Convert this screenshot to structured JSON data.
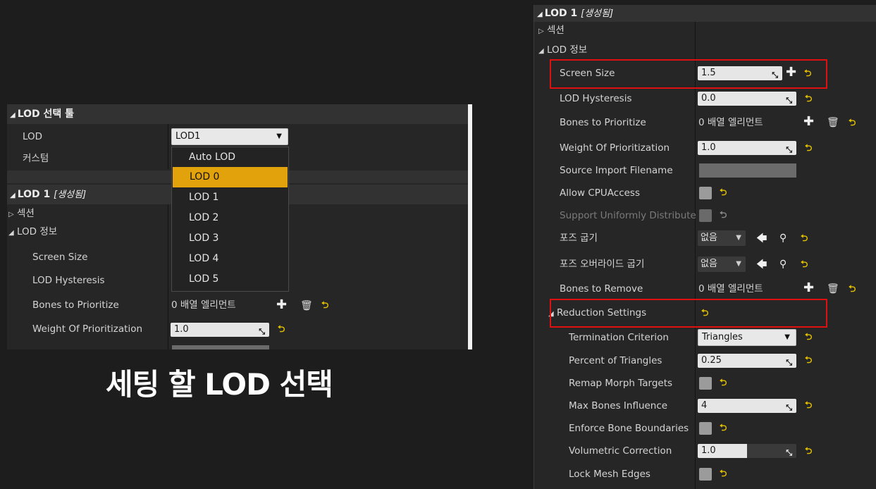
{
  "left_panel": {
    "category_lod_tool": "LOD 선택 툴",
    "lod_label": "LOD",
    "lod_selected": "LOD1",
    "custom_label": "커스텀",
    "category_lod1": "LOD 1",
    "generated_tag": "[생성됨]",
    "section_label": "섹션",
    "lod_info_label": "LOD 정보",
    "screen_size": "Screen Size",
    "lod_hysteresis": "LOD Hysteresis",
    "bones_to_prioritize": "Bones to Prioritize",
    "bones_value": "0 배열 엘리먼트",
    "weight_of_prioritization": "Weight Of Prioritization",
    "weight_value": "1.0",
    "dropdown_options": [
      "Auto LOD",
      "LOD 0",
      "LOD 1",
      "LOD 2",
      "LOD 3",
      "LOD 4",
      "LOD 5"
    ],
    "dropdown_highlighted": "LOD 0"
  },
  "caption": "세팅 할 LOD 선택",
  "right_panel": {
    "category_lod1": "LOD 1",
    "generated_tag": "[생성됨]",
    "section_label": "섹션",
    "lod_info_label": "LOD 정보",
    "screen_size": "Screen Size",
    "screen_size_value": "1.5",
    "lod_hysteresis": "LOD Hysteresis",
    "lod_hysteresis_value": "0.0",
    "bones_to_prioritize": "Bones to Prioritize",
    "bones_to_prioritize_value": "0 배열 엘리먼트",
    "weight_of_prioritization": "Weight Of Prioritization",
    "weight_value": "1.0",
    "source_import_filename": "Source Import Filename",
    "allow_cpu_access": "Allow CPUAccess",
    "support_uniformly_distribute": "Support Uniformly Distribute",
    "pose_bake": "포즈 굽기",
    "pose_bake_value": "없음",
    "pose_override_bake": "포즈 오버라이드 굽기",
    "pose_override_value": "없음",
    "bones_to_remove": "Bones to Remove",
    "bones_to_remove_value": "0 배열 엘리먼트",
    "reduction_settings": "Reduction Settings",
    "termination_criterion": "Termination Criterion",
    "termination_value": "Triangles",
    "percent_of_triangles": "Percent of Triangles",
    "percent_value": "0.25",
    "remap_morph_targets": "Remap Morph Targets",
    "max_bones_influence": "Max Bones Influence",
    "max_bones_value": "4",
    "enforce_bone_boundaries": "Enforce Bone Boundaries",
    "volumetric_correction": "Volumetric Correction",
    "volumetric_value": "1.0",
    "lock_mesh_edges": "Lock Mesh Edges"
  },
  "icons": {
    "reset": "reset-arrow-icon",
    "add": "plus-icon",
    "delete": "trash-icon",
    "drag": "drag-arrows-icon",
    "browse": "arrow-left-icon",
    "search": "magnifier-icon"
  }
}
